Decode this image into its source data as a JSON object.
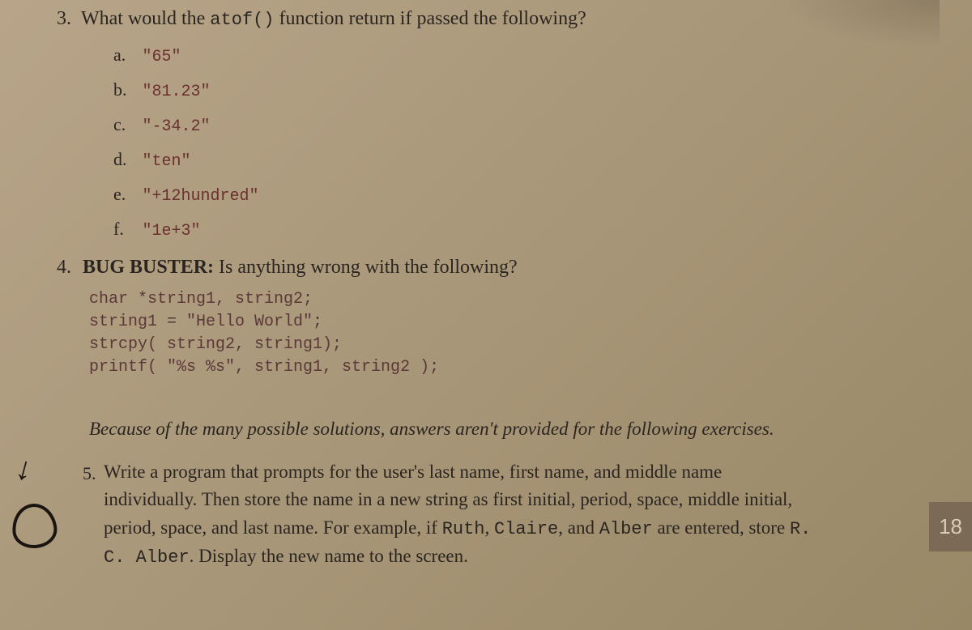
{
  "q3": {
    "num": "3.",
    "text_part1": "What would the ",
    "code": "atof()",
    "text_part2": " function return if passed the following?",
    "options": [
      {
        "letter": "a.",
        "code": "\"65\""
      },
      {
        "letter": "b.",
        "code": "\"81.23\""
      },
      {
        "letter": "c.",
        "code": "\"-34.2\""
      },
      {
        "letter": "d.",
        "code": "\"ten\""
      },
      {
        "letter": "e.",
        "code": "\"+12hundred\""
      },
      {
        "letter": "f.",
        "code": "\"1e+3\""
      }
    ]
  },
  "q4": {
    "num": "4.",
    "bold_title": "BUG BUSTER:",
    "text": " Is anything wrong with the following?",
    "code": "char *string1, string2;\nstring1 = \"Hello World\";\nstrcpy( string2, string1);\nprintf( \"%s %s\", string1, string2 );"
  },
  "note": "Because of the many possible solutions, answers aren't provided for the following exercises.",
  "q5": {
    "num": "5.",
    "text_part1": "Write a program that prompts for the user's last name, first name, and middle name individually. Then store the name in a new string as first initial, period, space, middle initial, period, space, and last name. For example, if ",
    "code1": "Ruth",
    "text_part2": ", ",
    "code2": "Claire",
    "text_part3": ", and ",
    "code3": "Alber",
    "text_part4": " are entered, store ",
    "code4": "R. C. Alber",
    "text_part5": ". Display the new name to the screen."
  },
  "page_tab": "18"
}
